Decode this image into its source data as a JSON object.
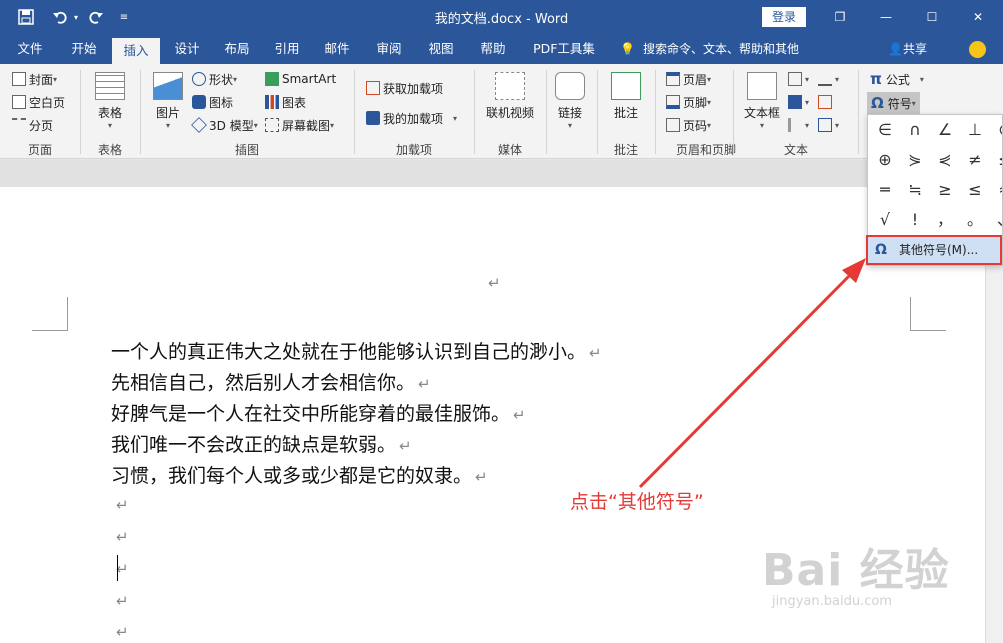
{
  "window": {
    "title": "我的文档.docx  -  Word",
    "login_label": "登录",
    "controls": [
      "❐",
      "—",
      "☐",
      "✕"
    ]
  },
  "quick_access": {
    "save_icon": "save-icon",
    "undo_icon": "undo-icon",
    "redo_icon": "redo-icon",
    "customize_icon": "customize-icon"
  },
  "tabs": [
    "文件",
    "开始",
    "插入",
    "设计",
    "布局",
    "引用",
    "邮件",
    "审阅",
    "视图",
    "帮助",
    "PDF工具集"
  ],
  "active_tab": "插入",
  "tell_me": "搜索命令、文本、帮助和其他",
  "share_label": "共享",
  "ribbon": {
    "pages": {
      "cover": "封面",
      "blank": "空白页",
      "break": "分页",
      "label": "页面"
    },
    "tables": {
      "table": "表格",
      "label": "表格"
    },
    "illustrations": {
      "picture": "图片",
      "shapes": "形状",
      "icons": "图标",
      "model3d": "3D 模型",
      "smartart": "SmartArt",
      "chart": "图表",
      "screenshot": "屏幕截图",
      "label": "插图"
    },
    "addins": {
      "get": "获取加载项",
      "mine": "我的加载项",
      "label": "加载项"
    },
    "media": {
      "video": "联机视频",
      "label": "媒体"
    },
    "links": {
      "link": "链接"
    },
    "comments": {
      "comment": "批注",
      "label": "批注"
    },
    "headerfooter": {
      "header": "页眉",
      "footer": "页脚",
      "pagenum": "页码",
      "label": "页眉和页脚"
    },
    "text": {
      "textbox": "文本框",
      "label": "文本"
    },
    "symbols": {
      "equation": "公式",
      "symbol": "符号"
    }
  },
  "symbol_gallery": {
    "symbols": [
      "∈",
      "∩",
      "∠",
      "⊥",
      "⊙",
      "⊕",
      "⋟",
      "⋞",
      "≠",
      "≤",
      "═",
      "≒",
      "≥",
      "≤",
      "≈",
      "√",
      "!",
      "，",
      "。",
      "、"
    ],
    "more": "其他符号(M)..."
  },
  "document": {
    "lines": [
      "一个人的真正伟大之处就在于他能够认识到自己的渺小。",
      "先相信自己，然后别人才会相信你。",
      "好脾气是一个人在社交中所能穿着的最佳服饰。",
      "我们唯一不会改正的缺点是软弱。",
      "习惯，我们每个人或多或少都是它的奴隶。"
    ],
    "paragraph_mark": "↵"
  },
  "annotation": "点击“其他符号”",
  "watermark": {
    "brand": "Bai 经验",
    "url": "jingyan.baidu.com"
  },
  "colors": {
    "accent": "#2b579a",
    "highlight": "#e53935"
  }
}
